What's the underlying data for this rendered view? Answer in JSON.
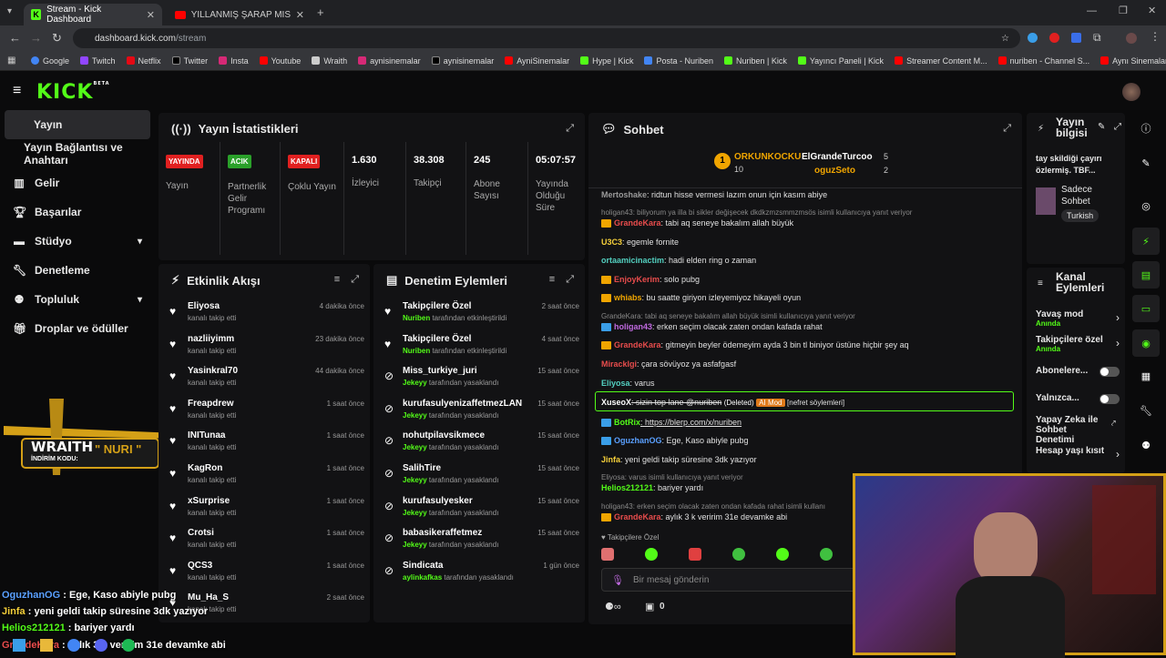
{
  "browser": {
    "tabs": [
      {
        "title": "Stream - Kick Dashboard"
      },
      {
        "title": "YILLANMIŞ ŞARAP MİSALİ. | LO"
      }
    ],
    "new_tab": "+",
    "url_host": "dashboard.kick.com",
    "url_path": "/stream",
    "bookmarks": [
      "Google",
      "Twitch",
      "Netflix",
      "Twitter",
      "Insta",
      "Youtube",
      "Wraith",
      "aynisinemalar",
      "aynisinemalar",
      "AyniSinemalar",
      "Hype | Kick",
      "Posta - Nuriben",
      "Nuriben | Kick",
      "Yayıncı Paneli | Kick",
      "Streamer Content M...",
      "nuriben - Channel S...",
      "Aynı Sinemalar - Ça..."
    ]
  },
  "kick": {
    "logo": "KICK",
    "logo_tag": "BETA"
  },
  "sidebar": {
    "items": [
      {
        "label": "Yayın",
        "icon": "broadcast-icon"
      },
      {
        "label": "Yayın Bağlantısı ve Anahtarı",
        "icon": ""
      },
      {
        "label": "Gelir",
        "icon": "chart-icon"
      },
      {
        "label": "Başarılar",
        "icon": "trophy-icon"
      },
      {
        "label": "Stüdyo",
        "icon": "studio-icon"
      },
      {
        "label": "Denetleme",
        "icon": "wrench-icon"
      },
      {
        "label": "Topluluk",
        "icon": "community-icon"
      },
      {
        "label": "Droplar ve ödüller",
        "icon": "gift-icon"
      }
    ]
  },
  "stats": {
    "title": "Yayın İstatistikleri",
    "cells": [
      {
        "badge": "YAYINDA",
        "label": "Yayın",
        "color": "#e02020"
      },
      {
        "badge": "ACIK",
        "label": "Partnerlik Gelir Programı",
        "color": "#2aa02a"
      },
      {
        "badge": "KAPALI",
        "label": "Çoklu Yayın",
        "color": "#e02020"
      },
      {
        "value": "1.630",
        "label": "İzleyici"
      },
      {
        "value": "38.308",
        "label": "Takipçi"
      },
      {
        "value": "245",
        "label": "Abone Sayısı"
      },
      {
        "value": "05:07:57",
        "label": "Yayında Olduğu Süre"
      }
    ]
  },
  "activity": {
    "title": "Etkinlik Akışı",
    "rows": [
      {
        "name": "Eliyosa",
        "sub": "kanalı takip etti",
        "time": "4 dakika önce"
      },
      {
        "name": "nazliiyimm",
        "sub": "kanalı takip etti",
        "time": "23 dakika önce"
      },
      {
        "name": "Yasinkral70",
        "sub": "kanalı takip etti",
        "time": "44 dakika önce"
      },
      {
        "name": "Freapdrew",
        "sub": "kanalı takip etti",
        "time": "1 saat önce"
      },
      {
        "name": "INITunaa",
        "sub": "kanalı takip etti",
        "time": "1 saat önce"
      },
      {
        "name": "KagRon",
        "sub": "kanalı takip etti",
        "time": "1 saat önce"
      },
      {
        "name": "xSurprise",
        "sub": "kanalı takip etti",
        "time": "1 saat önce"
      },
      {
        "name": "Crotsi",
        "sub": "kanalı takip etti",
        "time": "1 saat önce"
      },
      {
        "name": "QCS3",
        "sub": "kanalı takip etti",
        "time": "1 saat önce"
      },
      {
        "name": "Mu_Ha_S",
        "sub": "kanalı takip etti",
        "time": "2 saat önce"
      }
    ]
  },
  "moderation": {
    "title": "Denetim Eylemleri",
    "rows": [
      {
        "name": "Takipçilere Özel",
        "by": "Nuriben",
        "sub": " tarafından etkinleştirildi",
        "time": "2 saat önce",
        "icon": "heart-icon"
      },
      {
        "name": "Takipçilere Özel",
        "by": "Nuriben",
        "sub": " tarafından etkinleştirildi",
        "time": "4 saat önce",
        "icon": "heart-icon"
      },
      {
        "name": "Miss_turkiye_juri",
        "by": "Jekeyy",
        "sub": " tarafından yasaklandı",
        "time": "15 saat önce",
        "icon": "ban-icon"
      },
      {
        "name": "kurufasulyenizaffetmezLAN",
        "by": "Jekeyy",
        "sub": " tarafından yasaklandı",
        "time": "15 saat önce",
        "icon": "ban-icon"
      },
      {
        "name": "nohutpilavsikmece",
        "by": "Jekeyy",
        "sub": " tarafından yasaklandı",
        "time": "15 saat önce",
        "icon": "ban-icon"
      },
      {
        "name": "SalihTire",
        "by": "Jekeyy",
        "sub": " tarafından yasaklandı",
        "time": "15 saat önce",
        "icon": "ban-icon"
      },
      {
        "name": "kurufasulyesker",
        "by": "Jekeyy",
        "sub": " tarafından yasaklandı",
        "time": "15 saat önce",
        "icon": "ban-icon"
      },
      {
        "name": "babasikeraffetmez",
        "by": "Jekeyy",
        "sub": " tarafından yasaklandı",
        "time": "15 saat önce",
        "icon": "ban-icon"
      },
      {
        "name": "Sindicata",
        "by": "aylinkafkas",
        "sub": " tarafından yasaklandı",
        "time": "1 gün önce",
        "icon": "ban-icon"
      }
    ]
  },
  "chat": {
    "title": "Sohbet",
    "top": {
      "first_name": "ORKUNKOCKU",
      "first_count": "10",
      "rank": "1",
      "second_name": "ElGrandeTurcoo",
      "second_count": "5",
      "third_name": "oguzSeto",
      "third_count": "2"
    },
    "messages": [
      {
        "user": "Mertoshake",
        "color": "#9a9a9a",
        "text": ": ridtun hisse vermesi lazım onun için kasım abiye",
        "reply": ""
      },
      {
        "user": "",
        "color": "#888",
        "text": "",
        "reply": "holigan43: biliyorum ya illa bi sikler değişecek dkdkzmzsmmzmsös isimli kullanıcıya yanıt veriyor"
      },
      {
        "user": "GrandeKara",
        "color": "#e84c4c",
        "text": ": tabi aq seneye bakalım allah büyük",
        "reply": ""
      },
      {
        "user": "U3C3",
        "color": "#f6d03a",
        "text": ": egemle fornite",
        "reply": ""
      },
      {
        "user": "ortaamicinactim",
        "color": "#53d0c0",
        "text": ": hadi elden ring o zaman",
        "reply": ""
      },
      {
        "user": "EnjoyKerim",
        "color": "#e84c4c",
        "text": ": solo pubg",
        "reply": ""
      },
      {
        "user": "whiabs",
        "color": "#f0a500",
        "text": ": bu saatte giriyon izleyemiyoz hikayeli oyun",
        "reply": ""
      },
      {
        "user": "",
        "color": "#888",
        "text": "",
        "reply": "GrandeKara: tabi aq seneye bakalım allah büyük isimli kullanıcıya yanıt veriyor"
      },
      {
        "user": "holigan43",
        "color": "#c06ae0",
        "text": ": erken seçim olacak zaten ondan kafada rahat",
        "reply": ""
      },
      {
        "user": "GrandeKara",
        "color": "#e84c4c",
        "text": ": gitmeyin beyler ödemeyim ayda 3 bin tl biniyor üstüne hiçbir şey aq",
        "reply": ""
      },
      {
        "user": "Miracklgi",
        "color": "#e84c4c",
        "text": ": çara sövüyoz ya asfafgasf",
        "reply": ""
      },
      {
        "user": "Eliyosa",
        "color": "#53d0c0",
        "text": ": varus",
        "reply": ""
      },
      {
        "user": "XuseoX",
        "color": "#fff",
        "text": ": sizin top lane @nuriben",
        "reply": ""
      },
      {
        "user": "BotRix",
        "color": "#53fc18",
        "text": ": https://blerp.com/x/nuriben",
        "reply": ""
      },
      {
        "user": "OguzhanOG",
        "color": "#5aa0ff",
        "text": ": Ege, Kaso abiyle pubg",
        "reply": ""
      },
      {
        "user": "Jinfa",
        "color": "#f6d03a",
        "text": ": yeni geldi takip süresine 3dk yazıyor",
        "reply": ""
      },
      {
        "user": "",
        "color": "#888",
        "text": "",
        "reply": "Eliyosa: varus isimli kullanıcıya yanıt veriyor"
      },
      {
        "user": "Helios212121",
        "color": "#53fc18",
        "text": ": bariyer yardı",
        "reply": ""
      },
      {
        "user": "",
        "color": "#888",
        "text": "",
        "reply": "holigan43: erken seçim olacak zaten ondan kafada rahat isimli kullanı"
      },
      {
        "user": "GrandeKara",
        "color": "#e84c4c",
        "text": ": aylık 3 k veririm 31e devamke abi",
        "reply": ""
      }
    ],
    "deleted_tag": "(Deleted)",
    "aimod_tag": "AI Mod",
    "reason_tag": "[nefret söylemleri]",
    "followers_only": "Takipçilere Özel",
    "input_placeholder": "Bir mesaj gönderin",
    "footer_count": "0"
  },
  "stream_info": {
    "title": "Yayın bilgisi",
    "desc": "tay skildiği çayırı özlermiş. TBF...",
    "lang_label": "Sadece Sohbet",
    "lang_tag": "Turkish"
  },
  "channel_actions": {
    "title": "Kanal Eylemleri",
    "items": [
      {
        "label": "Yavaş mod",
        "sub": "Anında",
        "type": "chevron"
      },
      {
        "label": "Takipçilere özel",
        "sub": "Anında",
        "type": "chevron"
      },
      {
        "label": "Abonelere...",
        "sub": "",
        "type": "toggle"
      },
      {
        "label": "Yalnızca...",
        "sub": "",
        "type": "toggle"
      },
      {
        "label": "Yapay Zeka ile Sohbet Denetimi",
        "sub": "",
        "type": "external"
      },
      {
        "label": "Hesap yaşı kısıt",
        "sub": "",
        "type": "chevron"
      }
    ]
  },
  "overlay": {
    "promo_brand": "WRAITH",
    "promo_code_label": "İNDİRİM KODU:",
    "promo_code": "\" NURI \"",
    "lines": [
      {
        "user": "OguzhanOG",
        "color": "#5aa0ff",
        "text": " : Ege, Kaso abiyle pubg"
      },
      {
        "user": "Jinfa",
        "color": "#f6d03a",
        "text": " : yeni geldi takip süresine 3dk yazıyor"
      },
      {
        "user": "Helios212121",
        "color": "#53fc18",
        "text": " : bariyer yardı"
      },
      {
        "user": "GrandeKara",
        "color": "#e84c4c",
        "text": " : aylık 3 k veririm 31e devamke abi"
      }
    ]
  },
  "colors": {
    "accent": "#53fc18",
    "panel": "#121214",
    "webcam_border": "#d4a017"
  }
}
